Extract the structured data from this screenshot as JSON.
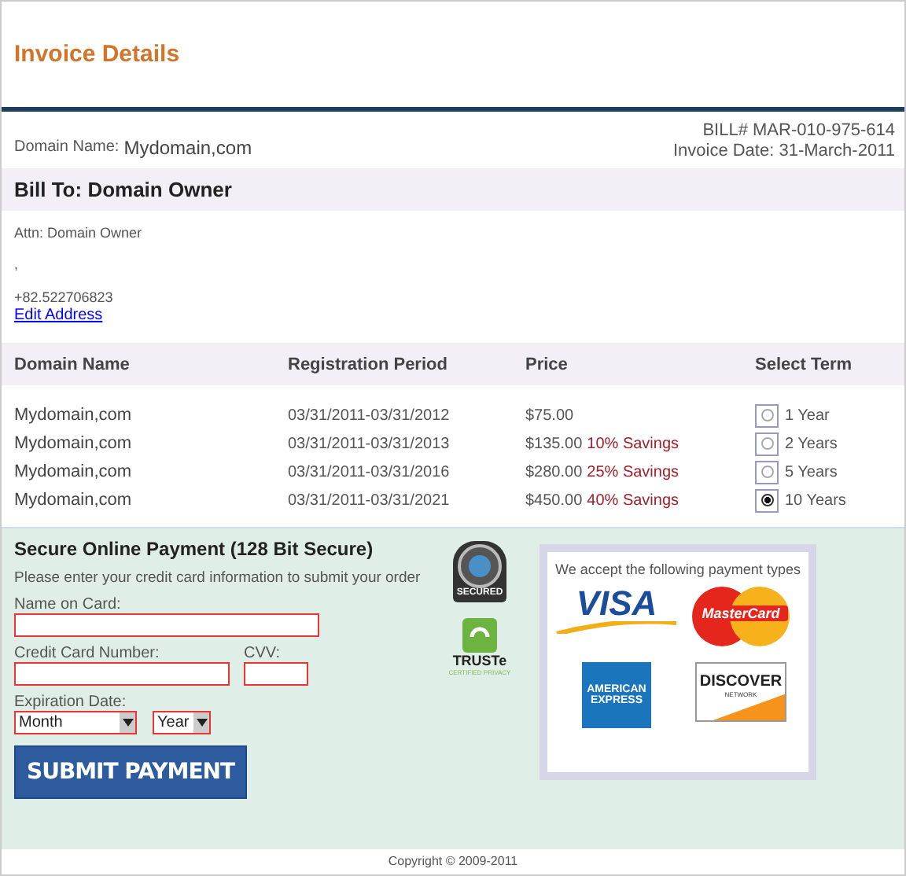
{
  "header": {
    "title": "Invoice Details"
  },
  "domain_info": {
    "label": "Domain Name:",
    "value": "Mydomain,com",
    "bill_number": "BILL# MAR-010-975-614",
    "invoice_date": "Invoice Date: 31-March-2011"
  },
  "bill_to": {
    "heading": "Bill To: Domain Owner",
    "attn": "Attn: Domain Owner",
    "line_2": ",",
    "phone": "+82.522706823",
    "edit_link": "Edit Address"
  },
  "table": {
    "columns": [
      "Domain Name",
      "Registration Period",
      "Price",
      "Select Term"
    ],
    "rows": [
      {
        "domain": "Mydomain,com",
        "period": "03/31/2011-03/31/2012",
        "price": "$75.00",
        "savings": "",
        "term": "1 Year",
        "selected": false
      },
      {
        "domain": "Mydomain,com",
        "period": "03/31/2011-03/31/2013",
        "price": "$135.00",
        "savings": "10% Savings",
        "term": "2 Years",
        "selected": false
      },
      {
        "domain": "Mydomain,com",
        "period": "03/31/2011-03/31/2016",
        "price": "$280.00",
        "savings": "25% Savings",
        "term": "5 Years",
        "selected": false
      },
      {
        "domain": "Mydomain,com",
        "period": "03/31/2011-03/31/2021",
        "price": "$450.00",
        "savings": "40% Savings",
        "term": "10 Years",
        "selected": true
      }
    ]
  },
  "payment": {
    "heading": "Secure Online Payment (128 Bit Secure)",
    "instructions": "Please enter your credit card information to submit your order",
    "name_label": "Name on Card:",
    "card_label": "Credit Card Number:",
    "cvv_label": "CVV:",
    "expiry_label": "Expiration Date:",
    "month_select": "Month",
    "year_select": "Year",
    "submit": "SUBMIT PAYMENT",
    "secured_badge": "SECURED",
    "truste_badge": "TRUSTe",
    "truste_caption": "CERTIFIED PRIVACY",
    "accepted_heading": "We accept the following payment types",
    "cards": [
      {
        "kind": "visa",
        "text": "VISA"
      },
      {
        "kind": "mastercard",
        "text": "MasterCard"
      },
      {
        "kind": "amex",
        "text": "AMERICAN",
        "text_2": "EXPRESS"
      },
      {
        "kind": "discover",
        "text": "DISCOVER",
        "text_2": "NETWORK"
      }
    ]
  },
  "footer": {
    "copyright": "Copyright © 2009-2011"
  }
}
